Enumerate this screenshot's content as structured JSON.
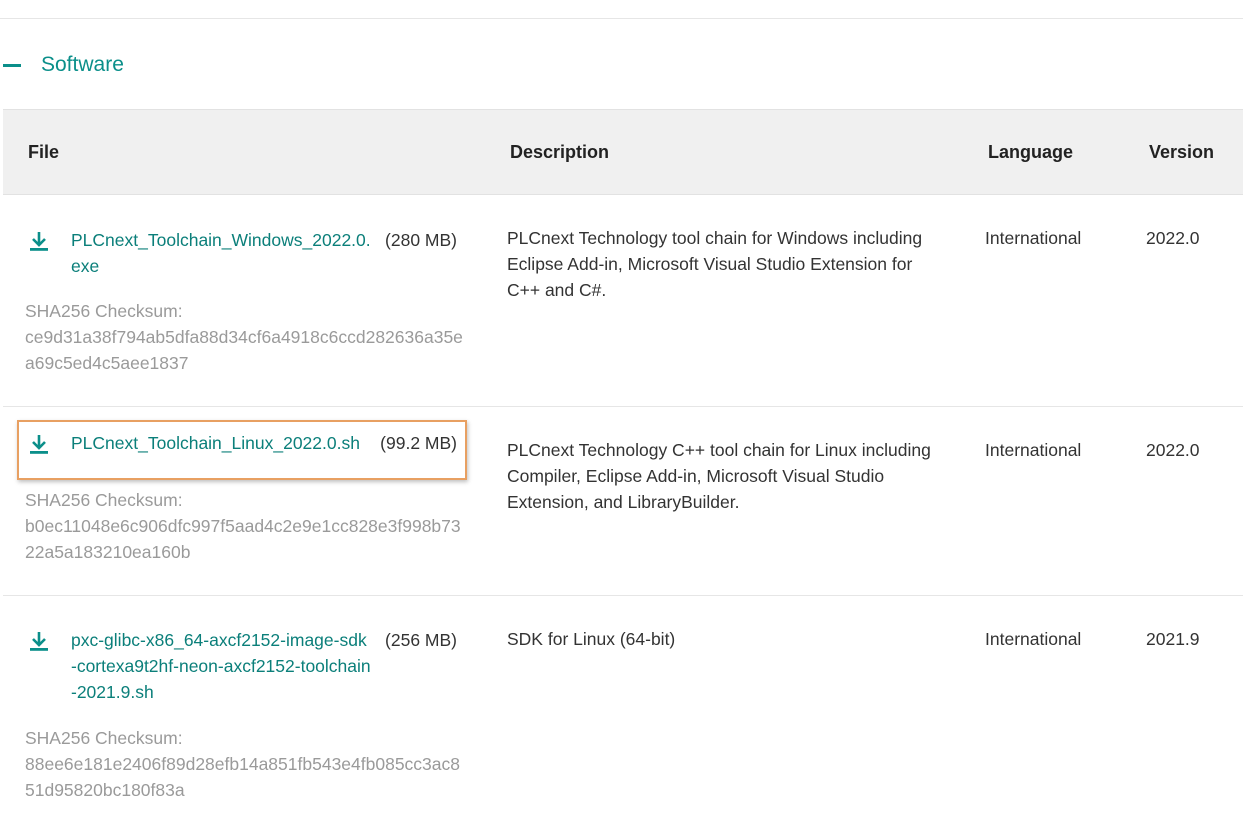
{
  "section": {
    "title": "Software",
    "toggle_icon": "minus-icon"
  },
  "table": {
    "headers": {
      "file": "File",
      "description": "Description",
      "language": "Language",
      "version": "Version"
    },
    "rows": [
      {
        "file_name": "PLCnext_Toolchain_Windows_2022.0.exe",
        "file_size": "(280 MB)",
        "checksum_label": "SHA256 Checksum:",
        "checksum": "ce9d31a38f794ab5dfa88d34cf6a4918c6ccd282636a35ea69c5ed4c5aee1837",
        "description": "PLCnext Technology tool chain for Windows including Eclipse Add-in, Microsoft Visual Studio Extension for C++ and C#.",
        "language": "International",
        "version": "2022.0"
      },
      {
        "file_name": "PLCnext_Toolchain_Linux_2022.0.sh",
        "file_size": "(99.2 MB)",
        "checksum_label": "SHA256 Checksum:",
        "checksum": "b0ec11048e6c906dfc997f5aad4c2e9e1cc828e3f998b7322a5a183210ea160b",
        "description": "PLCnext Technology C++ tool chain for Linux including Compiler, Eclipse Add-in, Microsoft Visual Studio Extension, and LibraryBuilder.",
        "language": "International",
        "version": "2022.0"
      },
      {
        "file_name": "pxc-glibc-x86_64-axcf2152-image-sdk-cortexa9t2hf-neon-axcf2152-toolchain-2021.9.sh",
        "file_size": "(256 MB)",
        "checksum_label": "SHA256 Checksum:",
        "checksum": "88ee6e181e2406f89d28efb14a851fb543e4fb085cc3ac851d95820bc180f83a",
        "description": "SDK for Linux (64-bit)",
        "language": "International",
        "version": "2021.9"
      }
    ]
  },
  "colors": {
    "accent": "#0b8f8a",
    "link": "#0b7f7a",
    "highlight_border": "#e8a062",
    "muted_text": "#9a9a9a"
  }
}
